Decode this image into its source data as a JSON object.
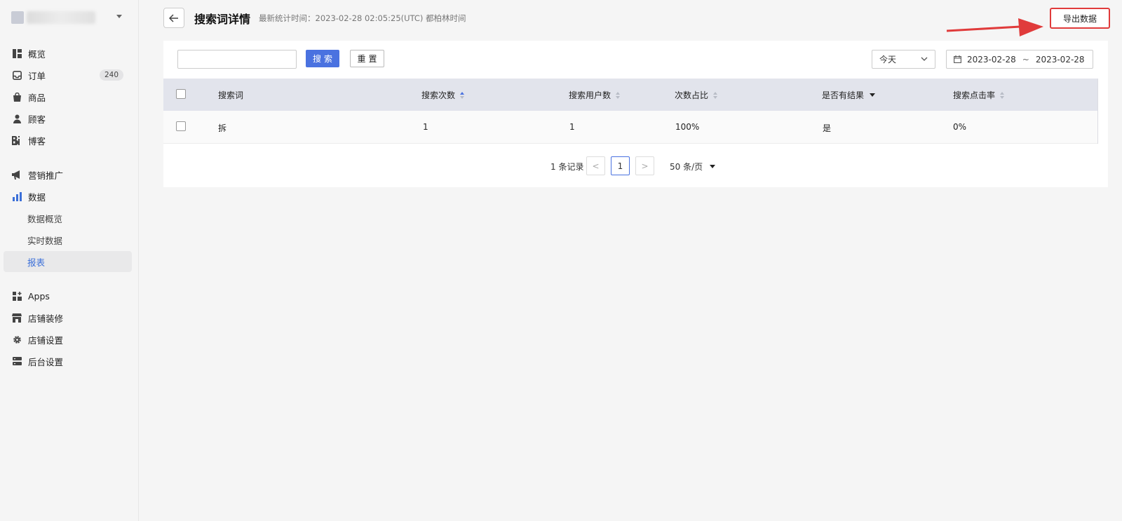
{
  "sidebar": {
    "items": [
      {
        "label": "概览",
        "icon": "dashboard-icon"
      },
      {
        "label": "订单",
        "icon": "inbox-icon",
        "badge": "240"
      },
      {
        "label": "商品",
        "icon": "shopping-bag-icon"
      },
      {
        "label": "顾客",
        "icon": "user-icon"
      },
      {
        "label": "博客",
        "icon": "blog-icon"
      },
      {
        "label": "营销推广",
        "icon": "megaphone-icon"
      },
      {
        "label": "数据",
        "icon": "bar-chart-icon"
      },
      {
        "label": "数据概览",
        "icon": ""
      },
      {
        "label": "实时数据",
        "icon": ""
      },
      {
        "label": "报表",
        "icon": ""
      },
      {
        "label": "Apps",
        "icon": "apps-icon"
      },
      {
        "label": "店铺装修",
        "icon": "storefront-icon"
      },
      {
        "label": "店铺设置",
        "icon": "gear-icon"
      },
      {
        "label": "后台设置",
        "icon": "server-icon"
      }
    ]
  },
  "header": {
    "title": "搜索词详情",
    "subtitle": "最新统计时间：2023-02-28 02:05:25(UTC) 都柏林时间",
    "export_label": "导出数据"
  },
  "toolbar": {
    "search_placeholder": "",
    "search_label": "搜索",
    "reset_label": "重置",
    "range_label": "今天",
    "date_start": "2023-02-28",
    "date_sep": "~",
    "date_end": "2023-02-28"
  },
  "table": {
    "columns": [
      "搜索词",
      "搜索次数",
      "搜索用户数",
      "次数占比",
      "是否有结果",
      "搜索点击率"
    ],
    "rows": [
      [
        "拆",
        "1",
        "1",
        "100%",
        "是",
        "0%"
      ]
    ]
  },
  "pagination": {
    "total": "1 条记录",
    "current_page": "1",
    "prev": "<",
    "next": ">",
    "page_size": "50 条/页"
  },
  "colors": {
    "primary": "#4a72e0",
    "highlight": "#e03b3b"
  }
}
